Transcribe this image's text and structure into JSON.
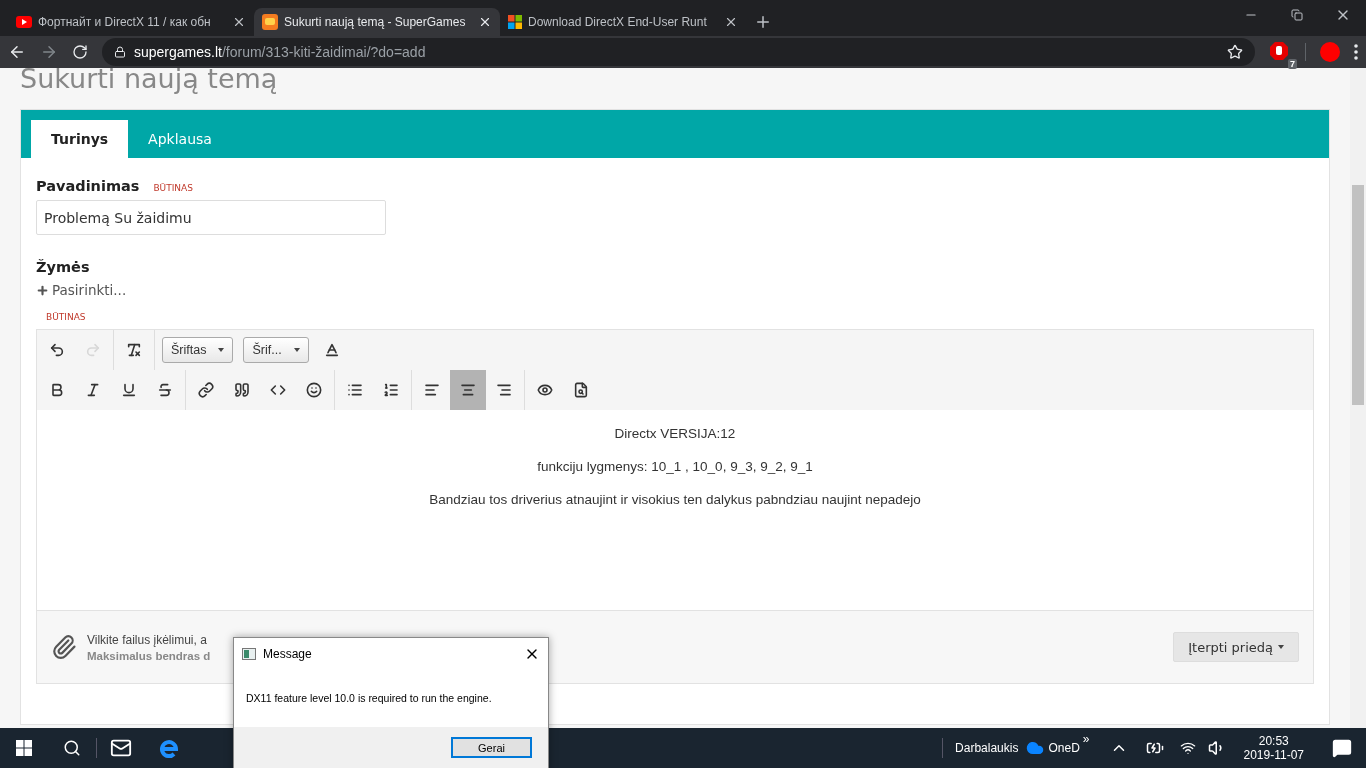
{
  "browser": {
    "tabs": [
      {
        "title": "Фортнайт и DirectX 11 / как обн",
        "selected": false
      },
      {
        "title": "Sukurti naują temą - SuperGames",
        "selected": true
      },
      {
        "title": "Download DirectX End-User Runt",
        "selected": false
      }
    ],
    "url": {
      "host": "supergames.lt",
      "path": "/forum/313-kiti-žaidimai/?do=add"
    },
    "extension_badge": "7"
  },
  "page": {
    "heading": "Sukurti naują temą",
    "tabs": [
      {
        "label": "Turinys",
        "selected": true
      },
      {
        "label": "Apklausa",
        "selected": false
      }
    ],
    "title_field": {
      "label": "Pavadinimas",
      "required": "BŪTINAS",
      "value": "Problemą Su žaidimu"
    },
    "tags": {
      "label": "Žymės",
      "action": "Pasirinkti..."
    },
    "editor": {
      "required": "BŪTINAS",
      "toolbar": [
        [
          [
            {
              "kind": "undo",
              "selected": false,
              "disabled": false
            },
            {
              "kind": "redo",
              "selected": false,
              "disabled": true
            }
          ],
          [
            {
              "kind": "clear-format",
              "selected": false,
              "disabled": false
            }
          ],
          [
            {
              "kind": "select",
              "label": "Šriftas"
            },
            {
              "kind": "select",
              "label": "Šrif..."
            },
            {
              "kind": "font-color",
              "selected": false,
              "disabled": false
            }
          ]
        ],
        [
          [
            {
              "kind": "bold",
              "selected": false,
              "disabled": false
            },
            {
              "kind": "italic",
              "selected": false,
              "disabled": false
            },
            {
              "kind": "underline",
              "selected": false,
              "disabled": false
            },
            {
              "kind": "strike",
              "selected": false,
              "disabled": false
            }
          ],
          [
            {
              "kind": "link",
              "selected": false,
              "disabled": false
            },
            {
              "kind": "quote",
              "selected": false,
              "disabled": false
            },
            {
              "kind": "code",
              "selected": false,
              "disabled": false
            },
            {
              "kind": "emoji",
              "selected": false,
              "disabled": false
            }
          ],
          [
            {
              "kind": "bullets",
              "selected": false,
              "disabled": false
            },
            {
              "kind": "numbering",
              "selected": false,
              "disabled": false
            }
          ],
          [
            {
              "kind": "align-left",
              "selected": false,
              "disabled": false
            },
            {
              "kind": "align-center",
              "selected": true,
              "disabled": false
            },
            {
              "kind": "align-right",
              "selected": false,
              "disabled": false
            }
          ],
          [
            {
              "kind": "preview",
              "selected": false,
              "disabled": false
            },
            {
              "kind": "page-preview",
              "selected": false,
              "disabled": false
            }
          ]
        ]
      ],
      "paragraphs": [
        "Directx VERSIJA:12",
        "funkciju lygmenys: 10_1 , 10_0, 9_3, 9_2, 9_1",
        "Bandziau tos driverius atnaujint ir visokius ten dalykus pabndziau naujint nepadejo"
      ],
      "attach": {
        "text": "Vilkite failus įkėlimui, a",
        "limit": "Maksimalus bendras d",
        "button": "Įterpti priedą"
      }
    }
  },
  "dialog": {
    "title": "Message",
    "message": "DX11 feature level 10.0 is required to run the engine.",
    "button": "Gerai"
  },
  "taskbar": {
    "desktop": "Darbalaukis",
    "onedrive": "OneD",
    "overflow": "»",
    "time": "20:53",
    "date": "2019-11-07"
  }
}
